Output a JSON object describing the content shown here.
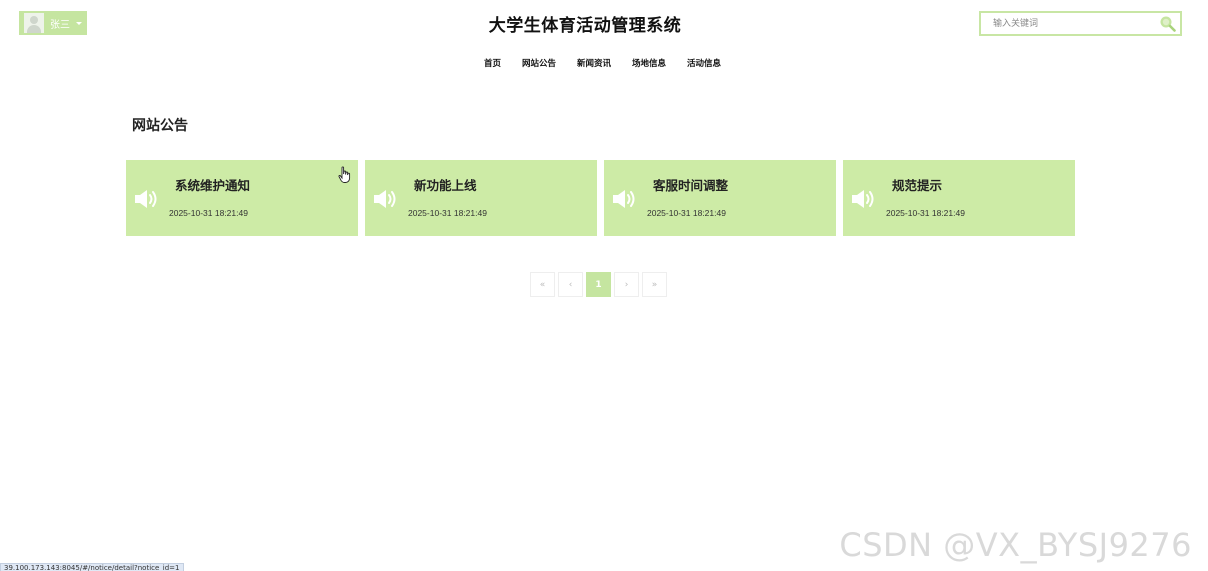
{
  "user": {
    "name": "张三"
  },
  "site": {
    "title": "大学生体育活动管理系统"
  },
  "search": {
    "placeholder": "输入关键词"
  },
  "nav": {
    "items": [
      {
        "label": "首页"
      },
      {
        "label": "网站公告"
      },
      {
        "label": "新闻资讯"
      },
      {
        "label": "场地信息"
      },
      {
        "label": "活动信息"
      }
    ]
  },
  "section": {
    "title": "网站公告"
  },
  "cards": [
    {
      "title": "系统维护通知",
      "date": "2025-10-31 18:21:49"
    },
    {
      "title": "新功能上线",
      "date": "2025-10-31 18:21:49"
    },
    {
      "title": "客服时间调整",
      "date": "2025-10-31 18:21:49"
    },
    {
      "title": "规范提示",
      "date": "2025-10-31 18:21:49"
    }
  ],
  "pagination": {
    "first": "«",
    "prev": "‹",
    "current": "1",
    "next": "›",
    "last": "»"
  },
  "watermark": "CSDN @VX_BYSJ9276",
  "status_url": "39.100.173.143:8045/#/notice/detail?notice_id=1",
  "colors": {
    "accent": "#c5e5a0",
    "card_bg": "#cdeba6"
  }
}
